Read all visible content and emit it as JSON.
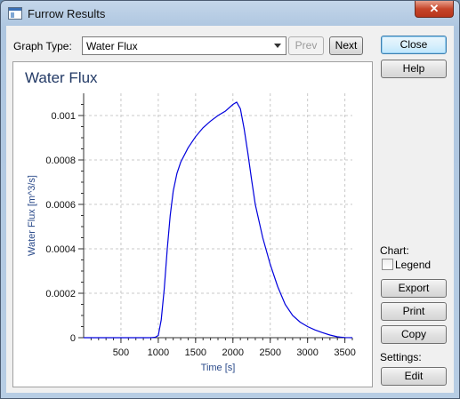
{
  "window": {
    "title": "Furrow Results",
    "close_glyph": "✕"
  },
  "graph_type": {
    "label": "Graph Type:",
    "selected": "Water Flux"
  },
  "nav": {
    "prev": "Prev",
    "next": "Next"
  },
  "actions": {
    "close": "Close",
    "help": "Help"
  },
  "chart_section": {
    "label": "Chart:",
    "legend_label": "Legend",
    "legend_checked": false,
    "export": "Export",
    "print": "Print",
    "copy": "Copy"
  },
  "settings_section": {
    "label": "Settings:",
    "edit": "Edit"
  },
  "chart_data": {
    "type": "line",
    "title": "Water Flux",
    "xlabel": "Time [s]",
    "ylabel": "Water Flux [m^3/s]",
    "xlim": [
      0,
      3600
    ],
    "ylim": [
      0,
      0.0011
    ],
    "xticks": [
      500,
      1000,
      1500,
      2000,
      2500,
      3000,
      3500
    ],
    "yticks": [
      0,
      0.0002,
      0.0004,
      0.0006,
      0.0008,
      0.001
    ],
    "ytick_labels": [
      "0",
      "0.0002",
      "0.0004",
      "0.0006",
      "0.0008",
      "0.001"
    ],
    "grid": true,
    "color": "#0000dd",
    "series": [
      {
        "x": [
          0,
          900,
          960,
          1000,
          1040,
          1080,
          1120,
          1160,
          1200,
          1250,
          1300,
          1400,
          1500,
          1600,
          1700,
          1800,
          1900,
          2000,
          2050,
          2100,
          2150,
          2200,
          2250,
          2300,
          2400,
          2500,
          2600,
          2700,
          2800,
          2900,
          3000,
          3100,
          3200,
          3300,
          3400,
          3500,
          3600
        ],
        "y": [
          0,
          0,
          2e-06,
          1e-05,
          8e-05,
          0.00022,
          0.0004,
          0.00055,
          0.00066,
          0.00074,
          0.00079,
          0.000855,
          0.000905,
          0.000945,
          0.000975,
          0.001,
          0.00102,
          0.00105,
          0.00106,
          0.00103,
          0.00094,
          0.00083,
          0.00071,
          0.0006,
          0.00045,
          0.00033,
          0.00023,
          0.00015,
          0.0001,
          7e-05,
          5e-05,
          3.5e-05,
          2.3e-05,
          1.2e-05,
          4e-06,
          1e-06,
          0
        ]
      }
    ]
  }
}
